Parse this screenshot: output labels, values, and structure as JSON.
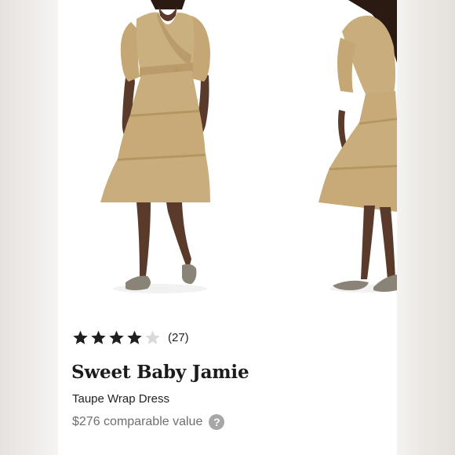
{
  "product": {
    "rating": 4,
    "max_rating": 5,
    "review_count": "(27)",
    "brand": "Sweet Baby Jamie",
    "name": "Taupe Wrap Dress",
    "price": "$276 comparable value",
    "help_icon": "?"
  },
  "images": {
    "front_view": "model-front-view",
    "side_view": "model-side-view"
  },
  "colors": {
    "dress": "#c9ad7c",
    "skin": "#5a3a2a",
    "text": "#222222",
    "muted_text": "#6f6f6f",
    "star_filled": "#1f1f1f",
    "star_empty": "#d9d9d9",
    "help_badge": "#a7a7a7"
  }
}
